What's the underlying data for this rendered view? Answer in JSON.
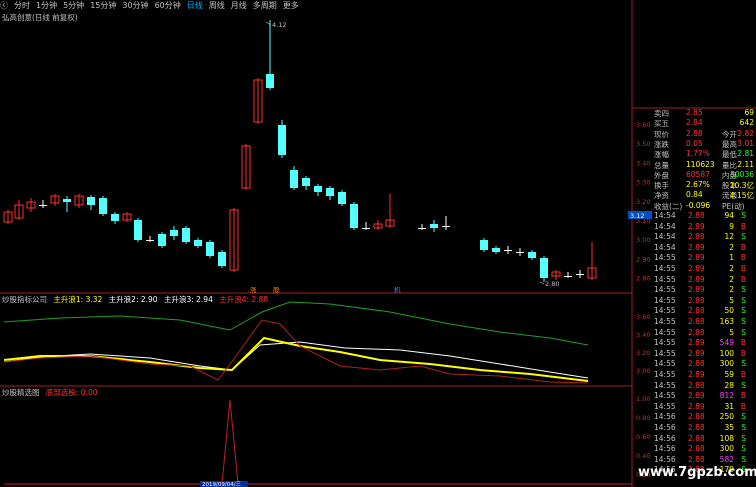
{
  "toolbar": {
    "items": [
      {
        "label": "ⓒ"
      },
      {
        "label": "分时"
      },
      {
        "label": "1分钟"
      },
      {
        "label": "5分钟"
      },
      {
        "label": "15分钟"
      },
      {
        "label": "30分钟"
      },
      {
        "label": "60分钟"
      },
      {
        "label": "日线",
        "active": true
      },
      {
        "label": "周线"
      },
      {
        "label": "月线"
      },
      {
        "label": "多周期"
      },
      {
        "label": "更多"
      }
    ]
  },
  "main_chart": {
    "subtitle": "弘高创意(日线 前复权)",
    "high_label": "4.12",
    "low_label": "2.80",
    "event_markers": [
      "涨",
      "股",
      "机"
    ],
    "price_labels": [
      "3.60",
      "3.50",
      "3.40",
      "3.30",
      "3.20",
      "3.10",
      "3.00",
      "2.90",
      "2.80"
    ],
    "current_price_tag": "3.12",
    "colors": {
      "up": "#ff3030",
      "down": "#54ffff",
      "flat": "#ffffff"
    }
  },
  "indicator1": {
    "name": "炒股指标公司",
    "lines": [
      {
        "label": "主升浪1: 3.32",
        "color": "#ffff00"
      },
      {
        "label": "主升浪2: 2.90",
        "color": "#ffffff"
      },
      {
        "label": "主升浪3: 2.94",
        "color": "#ffffff"
      },
      {
        "label": "主升浪4: 2.88",
        "color": "#ff3030"
      }
    ],
    "price_labels": [
      "3.60",
      "3.40",
      "3.20",
      "3.00"
    ]
  },
  "indicator2": {
    "name": "炒股精选图",
    "lines": [
      {
        "label": "底部选股: 0.00",
        "color": "#ff3030"
      }
    ],
    "date_label": "2019/09/04/三",
    "price_labels": [
      "1.00",
      "0.80",
      "0.60",
      "0.40",
      "0.20"
    ]
  },
  "quote_panel": {
    "rows": [
      {
        "left": "卖四",
        "lv": "2.85",
        "right": "",
        "rv": "69"
      },
      {
        "left": "买五",
        "lv": "2.84",
        "right": "",
        "rv": "642"
      },
      {
        "left": "现价",
        "lv": "2.88",
        "right": "今开",
        "rv": "2.82"
      },
      {
        "left": "涨跌",
        "lv": "0.05",
        "right": "最高",
        "rv": "3.01"
      },
      {
        "left": "涨幅",
        "lv": "1.77%",
        "right": "最低",
        "rv": "2.81"
      },
      {
        "left": "总量",
        "lv": "110623",
        "right": "量比",
        "rv": "2.11"
      },
      {
        "left": "外盘",
        "lv": "60587",
        "right": "内盘",
        "rv": "50036"
      },
      {
        "left": "换手",
        "lv": "2.67%",
        "right": "股本",
        "rv": "10.3亿"
      },
      {
        "left": "净资",
        "lv": "0.84",
        "right": "流通",
        "rv": "4.15亿"
      },
      {
        "left": "收益(二)",
        "lv": "-0.096",
        "right": "PE(动)",
        "rv": ""
      }
    ]
  },
  "ticks": [
    {
      "time": "14:54",
      "price": "2.88",
      "vol": "94",
      "dir": "S"
    },
    {
      "time": "14:54",
      "price": "2.89",
      "vol": "9",
      "dir": "B"
    },
    {
      "time": "14:54",
      "price": "2.88",
      "vol": "12",
      "dir": "S"
    },
    {
      "time": "14:54",
      "price": "2.89",
      "vol": "2",
      "dir": "B"
    },
    {
      "time": "14:55",
      "price": "2.89",
      "vol": "1",
      "dir": "B"
    },
    {
      "time": "14:55",
      "price": "2.89",
      "vol": "2",
      "dir": "B"
    },
    {
      "time": "14:55",
      "price": "2.89",
      "vol": "2",
      "dir": "B"
    },
    {
      "time": "14:55",
      "price": "2.89",
      "vol": "2",
      "dir": "S"
    },
    {
      "time": "14:55",
      "price": "2.88",
      "vol": "5",
      "dir": "S"
    },
    {
      "time": "14:55",
      "price": "2.88",
      "vol": "50",
      "dir": "S"
    },
    {
      "time": "14:55",
      "price": "2.88",
      "vol": "163",
      "dir": "S"
    },
    {
      "time": "14:55",
      "price": "2.88",
      "vol": "5",
      "dir": "S"
    },
    {
      "time": "14:55",
      "price": "2.89",
      "vol": "549",
      "dir": "B"
    },
    {
      "time": "14:55",
      "price": "2.89",
      "vol": "100",
      "dir": "B"
    },
    {
      "time": "14:55",
      "price": "2.88",
      "vol": "300",
      "dir": "S"
    },
    {
      "time": "14:55",
      "price": "2.89",
      "vol": "59",
      "dir": "B"
    },
    {
      "time": "14:55",
      "price": "2.88",
      "vol": "28",
      "dir": "S"
    },
    {
      "time": "14:55",
      "price": "2.89",
      "vol": "812",
      "dir": "B"
    },
    {
      "time": "14:55",
      "price": "2.89",
      "vol": "31",
      "dir": "B"
    },
    {
      "time": "14:56",
      "price": "2.88",
      "vol": "250",
      "dir": "S"
    },
    {
      "time": "14:56",
      "price": "2.88",
      "vol": "35",
      "dir": "S"
    },
    {
      "time": "14:56",
      "price": "2.88",
      "vol": "108",
      "dir": "S"
    },
    {
      "time": "14:56",
      "price": "2.88",
      "vol": "300",
      "dir": "S"
    },
    {
      "time": "14:56",
      "price": "2.88",
      "vol": "582",
      "dir": "S"
    },
    {
      "time": "14:56",
      "price": "2.88",
      "vol": "179",
      "dir": "S"
    }
  ],
  "watermark": "www.7gpzb.com"
}
